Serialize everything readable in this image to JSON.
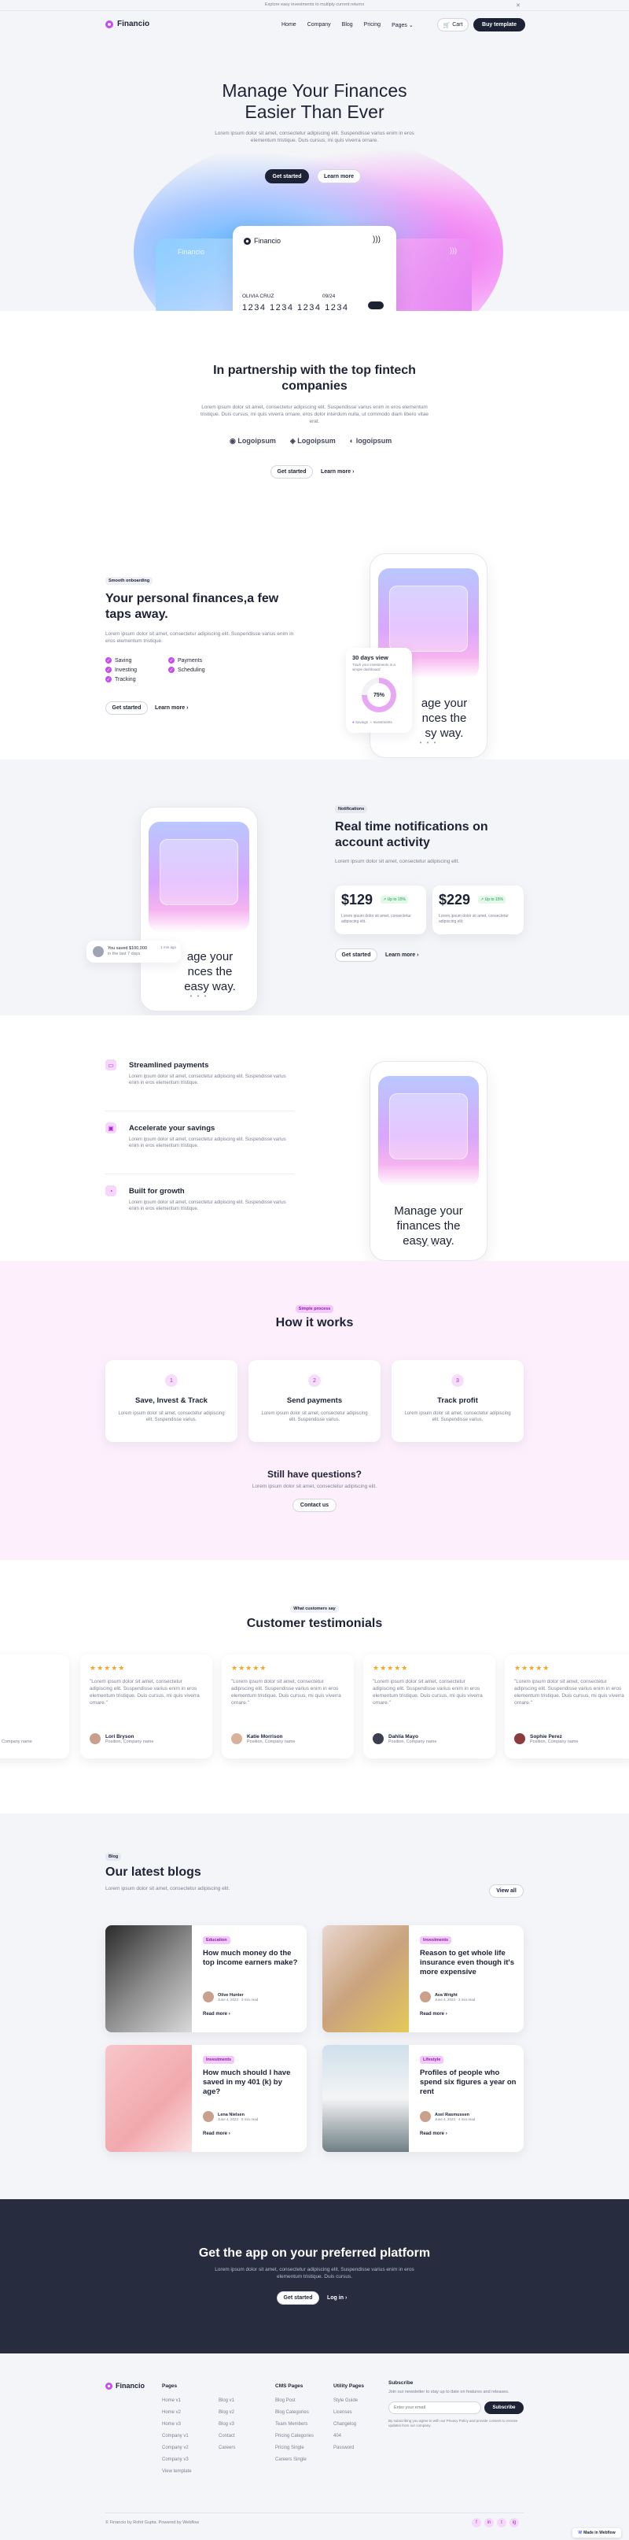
{
  "announcement": {
    "text": "Explore easy investments to multiply current returns",
    "close": "✕"
  },
  "nav": {
    "brand": "Financio",
    "links": [
      "Home",
      "Company",
      "Blog",
      "Pricing",
      "Pages"
    ],
    "cart": "Cart",
    "cta": "Buy template"
  },
  "hero": {
    "title_line1": "Manage Your Finances",
    "title_line2": "Easier Than Ever",
    "subtitle": "Lorem ipsum dolor sit amet, consectetur adipiscing elit. Suspendisse varius enim in eros elementum tristique. Duis cursus, mi quis viverra ornare.",
    "primary": "Get started",
    "secondary": "Learn more",
    "card": {
      "brand": "Financio",
      "holder": "OLIVIA CRUZ",
      "expiry": "09/24",
      "number": "1234 1234 1234 1234"
    },
    "side_card_brand": "Financio"
  },
  "partners": {
    "title_line1": "In partnership with the top fintech",
    "title_line2": "companies",
    "text": "Lorem ipsum dolor sit amet, consectetur adipiscing elit. Suspendisse varius enim in eros elementum tristique. Duis cursus, mi quis viverra ornare, eros dolor interdum nulla, ut commodo diam libero vitae erat.",
    "logos": [
      "Logoipsum",
      "Logoipsum",
      "logoipsum"
    ],
    "primary": "Get started",
    "secondary": "Learn more"
  },
  "onboarding": {
    "tag": "Smooth onboarding",
    "title_line1": "Your personal finances,a few",
    "title_line2": "taps away.",
    "text": "Lorem ipsum dolor sit amet, consectetur adipiscing elit. Suspendisse varius enim in eros elementum tristique.",
    "features": [
      "Saving",
      "Payments",
      "Investing",
      "Scheduling",
      "Tracking"
    ],
    "primary": "Get started",
    "secondary": "Learn more",
    "phone_caption_line1": "age your",
    "phone_caption_line2": "nces the",
    "phone_caption_line3": "sy way.",
    "widget": {
      "title": "30 days view",
      "subtitle": "Track your investments in a simple dashboard",
      "percent": "75%",
      "legend1": "Savings",
      "legend2": "Investments"
    }
  },
  "notifications": {
    "tag": "Notifications",
    "title_line1": "Real time notifications on",
    "title_line2": "account activity",
    "text": "Lorem ipsum dolor sit amet, consectetur adipiscing elit.",
    "stats": [
      {
        "value": "$129",
        "change": "Up to 15%",
        "text": "Lorem ipsum dolor sit amet, consectetur adipiscing elit."
      },
      {
        "value": "$229",
        "change": "Up to 15%",
        "text": "Lorem ipsum dolor sit amet, consectetur adipiscing elit."
      }
    ],
    "primary": "Get started",
    "secondary": "Learn more",
    "toast": {
      "text_line1": "You saved $100,000",
      "text_line2": "in the last 7 days",
      "time": "1 min ago"
    },
    "phone_caption_line1": "age your",
    "phone_caption_line2": "nces the",
    "phone_caption_line3": "easy way."
  },
  "features": {
    "items": [
      {
        "title": "Streamlined payments",
        "text": "Lorem ipsum dolor sit amet, consectetur adipiscing elit. Suspendisse varius enim in eros elementum tristique."
      },
      {
        "title": "Accelerate your savings",
        "text": "Lorem ipsum dolor sit amet, consectetur adipiscing elit. Suspendisse varius enim in eros elementum tristique."
      },
      {
        "title": "Built for growth",
        "text": "Lorem ipsum dolor sit amet, consectetur adipiscing elit. Suspendisse varius enim in eros elementum tristique."
      }
    ],
    "phone_caption_line1": "Manage your",
    "phone_caption_line2": "finances the",
    "phone_caption_line3": "easy way."
  },
  "how": {
    "tag": "Simple process",
    "title": "How it works",
    "steps": [
      {
        "num": "1",
        "title": "Save, Invest & Track",
        "text": "Lorem ipsum dolor sit amet, consectetur adipiscing elit. Suspendisse varius."
      },
      {
        "num": "2",
        "title": "Send payments",
        "text": "Lorem ipsum dolor sit amet, consectetur adipiscing elit. Suspendisse varius."
      },
      {
        "num": "3",
        "title": "Track profit",
        "text": "Lorem ipsum dolor sit amet, consectetur adipiscing elit. Suspendisse varius."
      }
    ],
    "q_title": "Still have questions?",
    "q_text": "Lorem ipsum dolor sit amet, consectetur adipiscing elit.",
    "q_button": "Contact us"
  },
  "testimonials": {
    "tag": "What customers say",
    "title": "Customer testimonials",
    "items": [
      {
        "quote": "\"Lorem ipsum dolor sit amet, consectetur adipiscing elit. Suspendisse varius enim in eros elementum tristique. Duis cursus, mi quis viverra ornare.\"",
        "name": "Lori Bryson",
        "role": "Position, Company name"
      },
      {
        "quote": "\"Lorem ipsum dolor sit amet, consectetur adipiscing elit. Suspendisse varius enim in eros elementum tristique. Duis cursus, mi quis viverra ornare.\"",
        "name": "Katie Morrison",
        "role": "Position, Company name"
      },
      {
        "quote": "\"Lorem ipsum dolor sit amet, consectetur adipiscing elit. Suspendisse varius enim in eros elementum tristique. Duis cursus, mi quis viverra ornare.\"",
        "name": "Dahlia Mayo",
        "role": "Position, Company name"
      },
      {
        "quote": "\"Lorem ipsum dolor sit amet, consectetur adipiscing elit. Suspendisse varius enim in eros elementum tristique. Duis cursus, mi quis viverra ornare.\"",
        "name": "Sophie Perez",
        "role": "Position, Company name"
      }
    ],
    "partial_role": "Company name"
  },
  "blogs": {
    "tag": "Blog",
    "title": "Our latest blogs",
    "text": "Lorem ipsum dolor sit amet, consectetur adipiscing elit.",
    "view_all": "View all",
    "posts": [
      {
        "tag": "Education",
        "title": "How much money do the top income earners make?",
        "author": "Olive Hunter",
        "date": "June 4, 2023 · 3 min read",
        "read": "Read more"
      },
      {
        "tag": "Investments",
        "title": "Reason to get whole life insurance even though it's more expensive",
        "author": "Ava Wright",
        "date": "June 4, 2023 · 3 min read",
        "read": "Read more"
      },
      {
        "tag": "Investments",
        "title": "How much should I have saved in my 401 (k) by age?",
        "author": "Lena Nielsen",
        "date": "June 4, 2023 · 5 min read",
        "read": "Read more"
      },
      {
        "tag": "Lifestyle",
        "title": "Profiles of people who spend six figures a year on rent",
        "author": "Axel Rasmussen",
        "date": "June 4, 2023 · 4 min read",
        "read": "Read more"
      }
    ]
  },
  "app_cta": {
    "title": "Get the app on your preferred platform",
    "text": "Lorem ipsum dolor sit amet, consectetur adipiscing elit. Suspendisse varius enim in eros elementum tristique. Duis cursus.",
    "primary": "Get started",
    "secondary": "Log in"
  },
  "footer": {
    "brand": "Financio",
    "col1": {
      "title": "Pages",
      "items": [
        "Home v1",
        "Home v2",
        "Home v3",
        "Company v1",
        "Company v2",
        "Company v3",
        "View template"
      ]
    },
    "col2": {
      "title": "",
      "items": [
        "Blog v1",
        "Blog v2",
        "Blog v3",
        "Contact",
        "Careers"
      ]
    },
    "col3": {
      "title": "CMS Pages",
      "items": [
        "Blog Post",
        "Blog Categories",
        "Team Members",
        "Pricing Categories",
        "Pricing Single",
        "Careers Single"
      ]
    },
    "col4": {
      "title": "Utility Pages",
      "items": [
        "Style Guide",
        "Licenses",
        "Changelog",
        "404",
        "Password"
      ]
    },
    "subscribe": {
      "title": "Subscribe",
      "text": "Join our newsletter to stay up to date on features and releases.",
      "placeholder": "Enter your email",
      "button": "Subscribe",
      "legal": "By subscribing you agree to with our Privacy Policy and provide consent to receive updates from our company."
    },
    "copyright": "© Financio by Rohit Gupta. Powered by Webflow",
    "social": [
      "f",
      "in",
      "t",
      "ig"
    ],
    "badge": "Made in Webflow"
  },
  "colors": {
    "dark": "#1d2235",
    "accent": "#c74cf0",
    "pink_bg": "#fdf0fc",
    "light_bg": "#f4f5f8"
  }
}
